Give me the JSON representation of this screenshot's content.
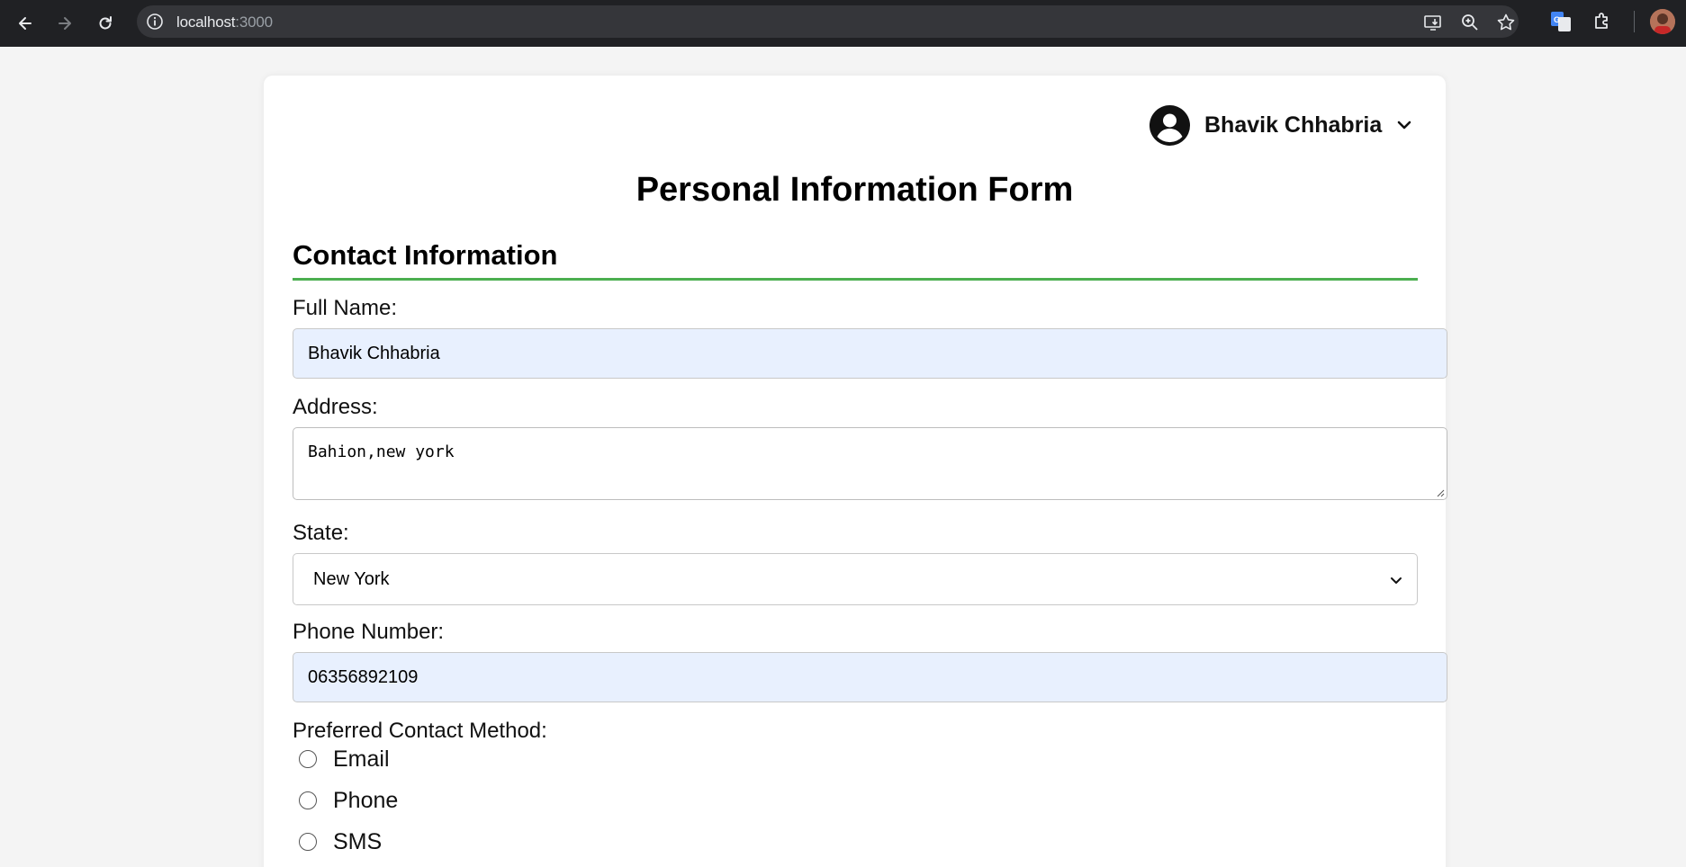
{
  "browser": {
    "url_host": "localhost",
    "url_port": ":3000"
  },
  "user": {
    "name": "Bhavik Chhabria"
  },
  "form": {
    "title": "Personal Information Form",
    "section_title": "Contact Information",
    "full_name_label": "Full Name:",
    "full_name_value": "Bhavik Chhabria",
    "address_label": "Address:",
    "address_value": "Bahion,new york",
    "state_label": "State:",
    "state_value": "New York",
    "phone_label": "Phone Number:",
    "phone_value": "06356892109",
    "contact_method_label": "Preferred Contact Method:",
    "contact_methods": [
      "Email",
      "Phone",
      "SMS"
    ]
  },
  "colors": {
    "section_rule": "#4caf50",
    "autofill_bg": "#e8f0fe"
  }
}
